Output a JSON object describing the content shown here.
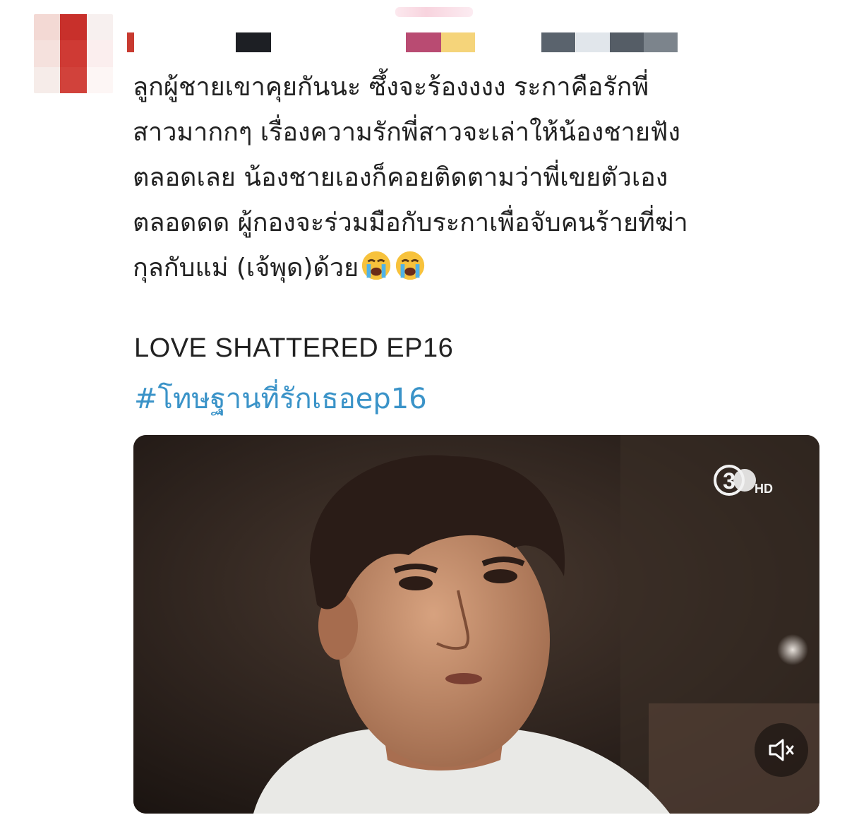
{
  "tweet": {
    "text": "ลูกผู้ชายเขาคุยกันนะ ซึ้งจะร้องงงง ระกาคือรักพี่\nสาวมากกๆ เรื่องความรักพี่สาวจะเล่าให้น้องชายฟัง\nตลอดเลย น้องชายเองก็คอยติดตามว่าพี่เขยตัวเอง\nตลอดดด ผู้กองจะร่วมมือกับระกาเพื่อจับคนร้ายที่ฆ่า\nกุลกับแม่ (เจ้พุด)ด้วย",
    "emojis": [
      "loudly-crying-face-icon",
      "loudly-crying-face-icon"
    ],
    "title": "LOVE SHATTERED EP16",
    "hashtag": "#โทษฐานที่รักเธอep16"
  },
  "media": {
    "type": "video",
    "channel_logo": "channel-3-hd-logo",
    "channel_number": "3",
    "channel_suffix": "HD",
    "mute_icon": "speaker-muted-icon"
  },
  "colors": {
    "hashtag": "#3a93c8",
    "text": "#222222",
    "background": "#ffffff"
  }
}
